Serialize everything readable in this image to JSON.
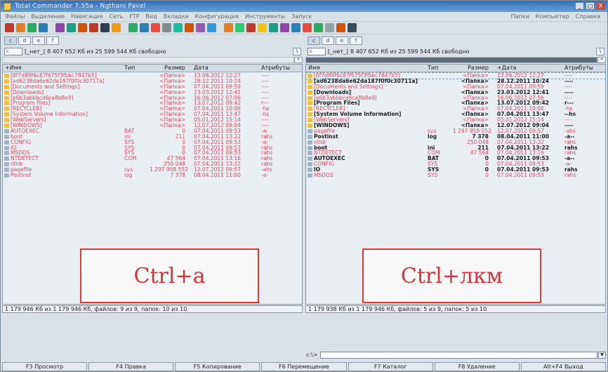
{
  "window": {
    "title": "Total Commander 7.55a - Ngthani Pavel",
    "buttons": [
      "_",
      "□",
      "X"
    ]
  },
  "menu": {
    "items": [
      "Файлы",
      "Выделение",
      "Навигация",
      "Сеть",
      "FTP",
      "Вид",
      "Вкладки",
      "Конфигурация",
      "Инструменты",
      "Запуск"
    ],
    "right_items": [
      "Папки",
      "Компьютер",
      "Справка"
    ]
  },
  "toolbar": {
    "icon_colors": [
      "#c0392b",
      "#e67e22",
      "#27ae60",
      "#2980b9",
      "#8e44ad",
      "#16a085",
      "#d35400",
      "#c0392b",
      "#2c3e50",
      "#f39c12",
      "#27ae60",
      "#2980b9",
      "#e74c3c",
      "#7f8c8d",
      "#1abc9c",
      "#d35400",
      "#9b59b6",
      "#3498db",
      "#e67e22",
      "#2ecc71",
      "#c0392b",
      "#f1c40f",
      "#16a085",
      "#8e44ad",
      "#2980b9",
      "#e74c3c",
      "#27ae60",
      "#95a5a6",
      "#d35400",
      "#34495e"
    ]
  },
  "left": {
    "drives": [
      "c",
      "d",
      "e",
      "f"
    ],
    "drive_combo": "c",
    "drive_label": "[_нет_]",
    "free_space": "8 407 652 Кб из 25 599 544 Кб свободно",
    "headers": {
      "name": "+Имя",
      "ext": "Тип",
      "size": "Размер",
      "date": "Дата",
      "attr": "Атрибуты"
    },
    "files": [
      {
        "name": "[0f7d89f6c87f675f3fbbc7847b5]",
        "ext": "",
        "size": "<Папка>",
        "date": "13.06.2012 12:27",
        "attr": "----",
        "type": "folder"
      },
      {
        "name": "[ad6238da6e62da187f0f0c30717a]",
        "ext": "",
        "size": "<Папка>",
        "date": "28.12.2011 10:24",
        "attr": "----",
        "type": "folder"
      },
      {
        "name": "[Documents and Settings]",
        "ext": "",
        "size": "<Папка>",
        "date": "07.04.2011 09:59",
        "attr": "----",
        "type": "folder"
      },
      {
        "name": "[Downloads]",
        "ext": "",
        "size": "<Папка>",
        "date": "23.03.2012 12:41",
        "attr": "----",
        "type": "folder"
      },
      {
        "name": "[e6b3abbbcd6ca8b8e9]",
        "ext": "",
        "size": "<Папка>",
        "date": "16.06.2012 07:56",
        "attr": "----",
        "type": "folder"
      },
      {
        "name": "[Program Files]",
        "ext": "",
        "size": "<Папка>",
        "date": "13.07.2012 09:42",
        "attr": "r---",
        "type": "folder"
      },
      {
        "name": "[RECYCLER]",
        "ext": "",
        "size": "<Папка>",
        "date": "07.04.2011 10:06",
        "attr": "-hs",
        "type": "folder"
      },
      {
        "name": "[System Volume Information]",
        "ext": "",
        "size": "<Папка>",
        "date": "07.04.2011 13:47",
        "attr": "-hs",
        "type": "folder"
      },
      {
        "name": "[WebServers]",
        "ext": "",
        "size": "<Папка>",
        "date": "05.01.2012 15:14",
        "attr": "----",
        "type": "folder"
      },
      {
        "name": "[WINDOWS]",
        "ext": "",
        "size": "<Папка>",
        "date": "12.07.2012 09:04",
        "attr": "----",
        "type": "folder"
      },
      {
        "name": "AUTOEXEC",
        "ext": "BAT",
        "size": "0",
        "date": "07.04.2011 09:53",
        "attr": "-a-",
        "type": "file"
      },
      {
        "name": "boot",
        "ext": "ini",
        "size": "211",
        "date": "07.04.2011 13:22",
        "attr": "rahs",
        "type": "file"
      },
      {
        "name": "CONFIG",
        "ext": "SYS",
        "size": "0",
        "date": "07.04.2011 09:53",
        "attr": "-a-",
        "type": "file"
      },
      {
        "name": "IO",
        "ext": "SYS",
        "size": "0",
        "date": "07.04.2011 09:53",
        "attr": "rahs",
        "type": "file"
      },
      {
        "name": "MSDOS",
        "ext": "SYS",
        "size": "0",
        "date": "07.04.2011 09:53",
        "attr": "rahs",
        "type": "file"
      },
      {
        "name": "NTDETECT",
        "ext": "COM",
        "size": "47 564",
        "date": "07.04.2011 13:16",
        "attr": "rahs",
        "type": "file"
      },
      {
        "name": "ntldr",
        "ext": "",
        "size": "250 048",
        "date": "07.04.2011 13:22",
        "attr": "rahs",
        "type": "file"
      },
      {
        "name": "pagefile",
        "ext": "sys",
        "size": "1 297 958 552",
        "date": "12.07.2012 09:57",
        "attr": "-ahs",
        "type": "file"
      },
      {
        "name": "Postinst",
        "ext": "log",
        "size": "7 378",
        "date": "08.04.2011 11:00",
        "attr": "-a-",
        "type": "file"
      }
    ],
    "status": "1 179 946 Кб из 1 179 946 Кб, файлов: 9 из 9, папок: 10 из 10",
    "overlay": "Ctrl+a"
  },
  "right": {
    "drives": [
      "c",
      "d",
      "e",
      "f"
    ],
    "drive_combo": "c",
    "drive_label": "[_нет_]",
    "free_space": "8 407 652 Кб из 25 599 544 Кб свободно",
    "headers": {
      "name": "Имя",
      "ext": "Тип",
      "size": "Размер",
      "date": "+Дата",
      "attr": "Атрибуты"
    },
    "files": [
      {
        "name": "[0f7d89f6c87f675f3fbbc7847b5]",
        "ext": "",
        "size": "<Папка>",
        "date": "13.06.2012 12:27",
        "attr": "----",
        "type": "folder",
        "selected": true
      },
      {
        "name": "[ad6238da6e62da187f0f0c30711a]",
        "ext": "",
        "size": "<Папка>",
        "date": "28.12.2011 10:24",
        "attr": "----",
        "type": "folder",
        "selected": false
      },
      {
        "name": "[Documents and Settings]",
        "ext": "",
        "size": "<Папка>",
        "date": "07.04.2011 09:59",
        "attr": "----",
        "type": "folder",
        "selected": true
      },
      {
        "name": "[Downloads]",
        "ext": "",
        "size": "<Папка>",
        "date": "23.03.2012 12:41",
        "attr": "----",
        "type": "folder",
        "selected": false
      },
      {
        "name": "[e6b3abbbcd6ca8b8e9]",
        "ext": "",
        "size": "<Папка>",
        "date": "16.06.2012 07:56",
        "attr": "----",
        "type": "folder",
        "selected": true
      },
      {
        "name": "[Program Files]",
        "ext": "",
        "size": "<Папка>",
        "date": "13.07.2012 09:42",
        "attr": "r---",
        "type": "folder",
        "selected": false
      },
      {
        "name": "[RECYCLER]",
        "ext": "",
        "size": "<Папка>",
        "date": "07.04.2011 10:06",
        "attr": "-hs",
        "type": "folder",
        "selected": true
      },
      {
        "name": "[System Volume Information]",
        "ext": "",
        "size": "<Папка>",
        "date": "07.04.2011 13:47",
        "attr": "--hs",
        "type": "folder",
        "selected": false
      },
      {
        "name": "[WebServers]",
        "ext": "",
        "size": "<Папка>",
        "date": "05.01.2012 15:14",
        "attr": "----",
        "type": "folder",
        "selected": true
      },
      {
        "name": "[WINDOWS]",
        "ext": "",
        "size": "<Папка>",
        "date": "12.07.2012 09:04",
        "attr": "----",
        "type": "folder",
        "selected": false
      },
      {
        "name": "pagefile",
        "ext": "sys",
        "size": "1 297 958 552",
        "date": "12.07.2012 09:57",
        "attr": "-ahs",
        "type": "file",
        "selected": true
      },
      {
        "name": "Postinst",
        "ext": "log",
        "size": "7 378",
        "date": "08.04.2011 11:00",
        "attr": "-a--",
        "type": "file",
        "selected": false
      },
      {
        "name": "ntldr",
        "ext": "",
        "size": "250 048",
        "date": "07.04.2011 13:22",
        "attr": "rahs",
        "type": "file",
        "selected": true
      },
      {
        "name": "boot",
        "ext": "ini",
        "size": "211",
        "date": "07.04.2011 13:22",
        "attr": "rahs",
        "type": "file",
        "selected": false
      },
      {
        "name": "NTDETECT",
        "ext": "COM",
        "size": "47 564",
        "date": "07.04.2011 13:16",
        "attr": "rahs",
        "type": "file",
        "selected": true
      },
      {
        "name": "AUTOEXEC",
        "ext": "BAT",
        "size": "0",
        "date": "07.04.2011 09:53",
        "attr": "-a--",
        "type": "file",
        "selected": false
      },
      {
        "name": "CONFIG",
        "ext": "SYS",
        "size": "0",
        "date": "07.04.2011 09:53",
        "attr": "-a-",
        "type": "file",
        "selected": true
      },
      {
        "name": "IO",
        "ext": "SYS",
        "size": "0",
        "date": "07.04.2011 09:53",
        "attr": "rahs",
        "type": "file",
        "selected": false
      },
      {
        "name": "MSDOS",
        "ext": "SYS",
        "size": "0",
        "date": "07.04.2011 09:53",
        "attr": "rahs",
        "type": "file",
        "selected": true
      }
    ],
    "status": "1 179 938 Кб из 1 179 946 Кб, файлов: 5 из 9, папок: 5 из 10",
    "overlay": "Ctrl+лкм"
  },
  "command": {
    "label": "c:\\>",
    "value": ""
  },
  "fkeys": [
    "F3 Просмотр",
    "F4 Правка",
    "F5 Копирование",
    "F6 Перемещение",
    "F7 Каталог",
    "F8 Удаление",
    "Alt+F4 Выход"
  ],
  "colors": {
    "selected_text": "#e8485c",
    "normal_text": "#1d1d1d",
    "overlay_border": "#dd3a3a",
    "title_bar": "#2f6fb8"
  }
}
